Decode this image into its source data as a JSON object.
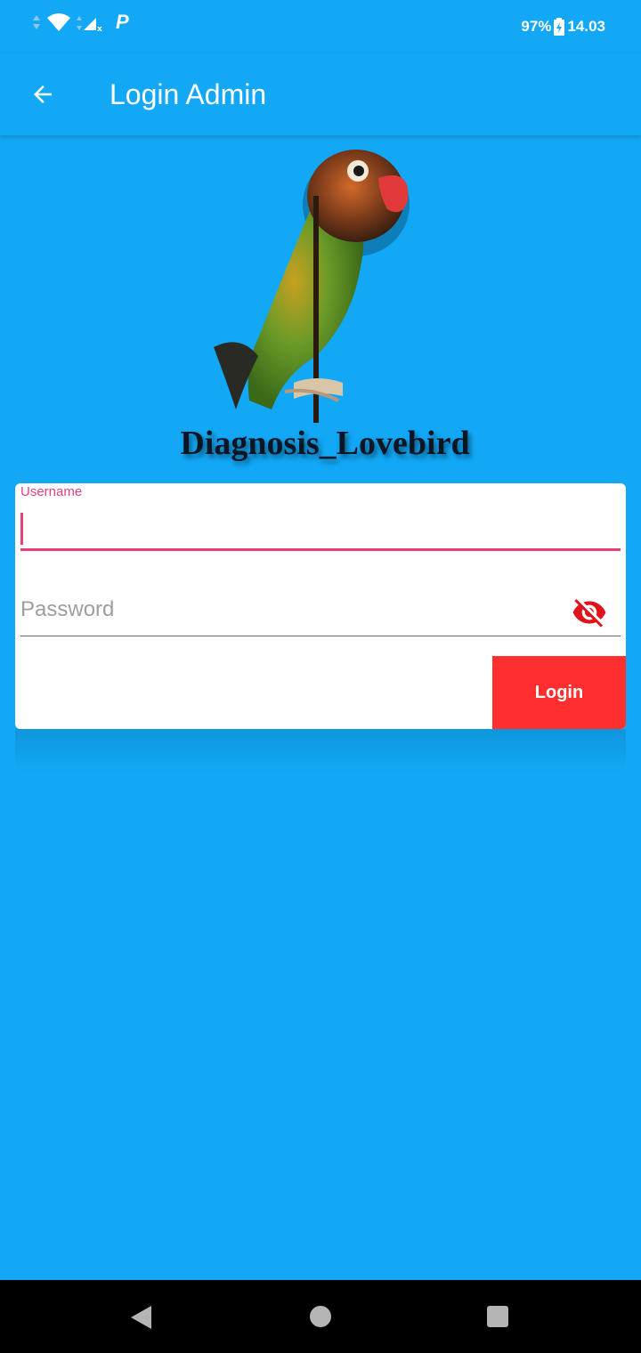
{
  "status_bar": {
    "battery": "97%",
    "time": "14.03",
    "icons": [
      "data-arrows-icon",
      "wifi-icon",
      "signal-off-icon",
      "parking-icon"
    ]
  },
  "app_bar": {
    "title": "Login Admin",
    "back_icon": "arrow-back-icon"
  },
  "logo": {
    "caption": "Diagnosis_Lovebird"
  },
  "form": {
    "username_label": "Username",
    "username_value": "",
    "password_placeholder": "Password",
    "password_toggle_icon": "visibility-off-icon",
    "login_label": "Login"
  },
  "colors": {
    "background": "#12a8f6",
    "accent": "#e8407a",
    "button": "#ff2f2f",
    "eye_icon": "#e0141a"
  },
  "nav_bar": {
    "icons": [
      "nav-back-icon",
      "nav-home-icon",
      "nav-recents-icon"
    ]
  }
}
